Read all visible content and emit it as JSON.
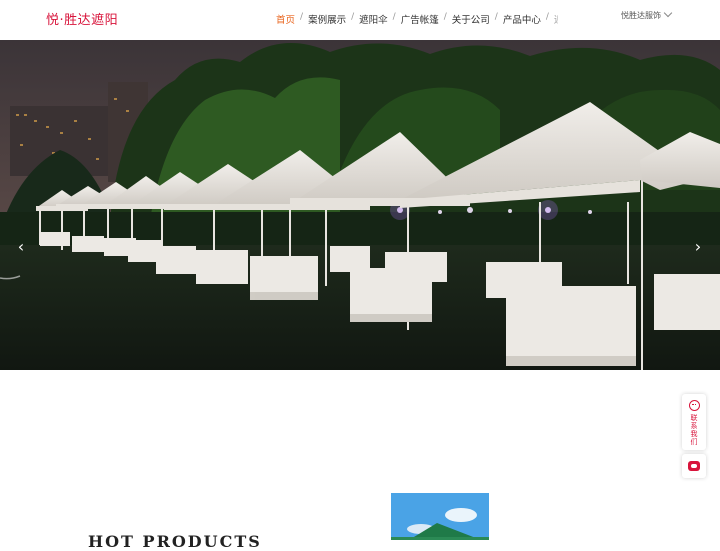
{
  "header": {
    "logo": "悦·胜达遮阳",
    "nav": [
      {
        "label": "首页",
        "active": true
      },
      {
        "label": "案例展示"
      },
      {
        "label": "遮阳伞"
      },
      {
        "label": "广告帐篷"
      },
      {
        "label": "关于公司"
      },
      {
        "label": "产品中心"
      },
      {
        "label": "遮阳"
      }
    ],
    "nav_separator": "/",
    "brand_menu": "悦胜达服饰"
  },
  "hero": {
    "prev_icon": "chevron-left-icon",
    "next_icon": "chevron-right-icon"
  },
  "side_toolbar": {
    "contact_label": "联系我们",
    "contact_icon": "chat-icon",
    "wechat_icon": "wechat-icon"
  },
  "hot_products": {
    "title": "HOT PRODUCTS"
  },
  "colors": {
    "brand": "#d8143b",
    "nav_active": "#e9641d"
  }
}
